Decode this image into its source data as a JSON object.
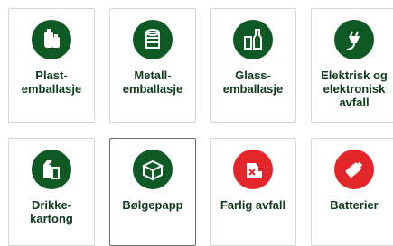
{
  "colors": {
    "green": "#0f5a24",
    "red": "#e3262c",
    "text": "#0d3a18"
  },
  "categories": [
    {
      "label": "Plast-\nemballasje",
      "icon": "plastic-packaging-icon",
      "color": "green"
    },
    {
      "label": "Metall-\nemballasje",
      "icon": "metal-can-icon",
      "color": "green"
    },
    {
      "label": "Glass-\nemballasje",
      "icon": "glass-bottle-icon",
      "color": "green"
    },
    {
      "label": "Elektrisk og\nelektronisk\navfall",
      "icon": "electric-plug-icon",
      "color": "green"
    },
    {
      "label": "Drikke-\nkartong",
      "icon": "drink-carton-icon",
      "color": "green"
    },
    {
      "label": "Bølgepapp",
      "icon": "cardboard-box-icon",
      "color": "green"
    },
    {
      "label": "Farlig avfall",
      "icon": "hazardous-waste-icon",
      "color": "red"
    },
    {
      "label": "Batterier",
      "icon": "battery-icon",
      "color": "red"
    }
  ]
}
